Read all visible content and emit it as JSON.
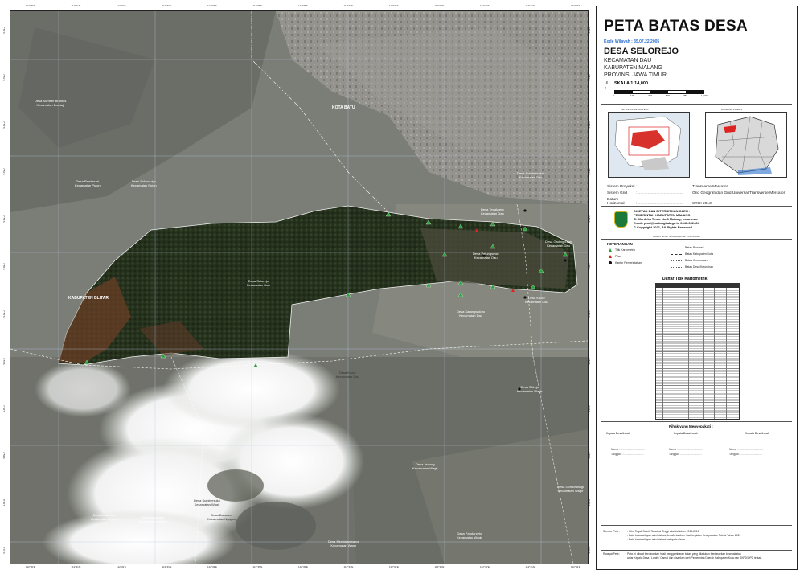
{
  "map": {
    "ticks_top": [
      "112°30'E",
      "112°31'E",
      "112°32'E",
      "112°33'E",
      "112°34'E",
      "112°35'E",
      "112°36'E",
      "112°37'E",
      "112°38'E",
      "112°39'E",
      "112°40'E",
      "112°41'E",
      "112°42'E"
    ],
    "ticks_side": [
      "7°50'S",
      "7°51'S",
      "7°52'S",
      "7°53'S",
      "7°54'S",
      "7°55'S",
      "7°56'S",
      "7°57'S",
      "7°58'S",
      "7°59'S",
      "8°00'S",
      "8°01'S"
    ],
    "labels": {
      "kota_batu": "KOTA BATU",
      "kab_blitar": "KABUPATEN BLITAR",
      "desa_selorejo": "Desa Selorejo\nKecamatan Dau",
      "desa_nw1": "Desa Sumber Brantas\nKecamatan Bumiaji",
      "desa_nw2": "Desa Pandesari\nKecamatan Pujon",
      "desa_nw3": "Desa Sukomulyo\nKecamatan Pujon",
      "desa_ne1": "Desa Sumbersekar\nKecamatan Dau",
      "desa_ne2": "Desa Tegalweru\nKecamatan Dau",
      "desa_e1": "Desa Gadingkulon\nKecamatan Dau",
      "desa_e2": "Desa Petungsewu\nKecamatan Dau",
      "desa_se1": "Desa Kucur\nKecamatan Dau",
      "desa_se2": "Desa Karangwidoro\nKecamatan Dau",
      "desa_s1": "Desa Kucur\nKecamatan Dau",
      "desa_s2": "Desa Sumbersuko\nKecamatan Wagir",
      "desa_s3": "Desa Babadan\nKecamatan Ngajum",
      "desa_s4": "Desa Jedong\nKecamatan Wagir",
      "desa_s5": "Desa Pandanrejo\nKecamatan Wagir",
      "desa_sw1": "Desa Kesamben\nKecamatan Ngajum",
      "desa_sw2": "Desa Banjarejo\nKecamatan Ngajum",
      "desa_far_se": "Desa Sitirejo\nKecamatan Wagir",
      "desa_far_se2": "Desa Gondowangi\nKecamatan Wagir",
      "desa_se3": "Desa Mendalanwangi\nKecamatan Wagir"
    }
  },
  "panel": {
    "title": "PETA BATAS DESA",
    "kode_wilayah": "Kode Wilayah : 35.07.22.2005",
    "desa": "DESA SELOREJO",
    "kecamatan": "KECAMATAN DAU",
    "kabupaten": "KABUPATEN MALANG",
    "provinsi": "PROVINSI JAWA TIMUR",
    "north": "U",
    "skala": "SKALA 1:14,000",
    "scale_ticks": [
      "0",
      "125",
      "250",
      "500",
      "750",
      "1,000"
    ],
    "inset1_title": "PETUNJUK LETAK PETA",
    "inset2_title": "DIAGRAM INDEKS",
    "meta": [
      {
        "key": "Sistem Proyeksi",
        "value": "Transverse Mercator"
      },
      {
        "key": "Sistem Grid",
        "value": "Grid Geografi dan Grid Universal Transverse Mercator"
      },
      {
        "key": "Datum Horizontal",
        "value": "SRGI 2013"
      }
    ],
    "publisher": [
      "DICETAK DAN DITERBITKAN OLEH :",
      "PEMERINTAH KABUPATEN MALANG",
      "Jl. Merdeka Timur No.3 Malang, Indonesia",
      "Email: pmd@malangkab.go.id 0341-392464",
      "© Copyright 2021, All Rights Reserved."
    ],
    "note": "Peta ini dibuat untuk keperluan inventarisasi",
    "keterangan_title": "KETERANGAN",
    "legend_left": [
      "Titik Kartometrik",
      "Pilar",
      "Kantor Pemerintahan"
    ],
    "legend_right": [
      "Batas Provinsi",
      "Batas Kabupaten/Kota",
      "Batas Kecamatan",
      "Batas Desa/Kelurahan"
    ],
    "table_title": "Daftar Titik Kartometrik",
    "pihak_title": "Pihak yang Menyepakati :",
    "kepala": [
      "Kepala Desa/Lurah",
      "Kepala Desa/Lurah",
      "Kepala Desa/Lurah"
    ],
    "sign_lines": [
      "Nama :  .................................",
      "Tanggal :  ............................."
    ],
    "sumber_label": "Sumber Peta :",
    "sumber_lines": [
      "- Citra Tegak Satelit Resolusi Tinggi akuisisi tahun 2013-2018",
      "- Data batas wilayah administrasi desa/kelurahan hasil kegiatan Kesepakatan Teknis Tahun 2021",
      "- Data batas wilayah administrasi kabupaten/kota"
    ],
    "riwayat_label": "Riwayat Peta :",
    "riwayat_lines": [
      "Peta ini dibuat berdasarkan hasil penggambaran batas yang dilakukan berdasarkan kesepakatan",
      "antar Kepala Desa / Lurah / Camat dan disahkan oleh Pemerintah Daerah Kabupaten/Kota dan SKPD/OPD terkait."
    ]
  }
}
